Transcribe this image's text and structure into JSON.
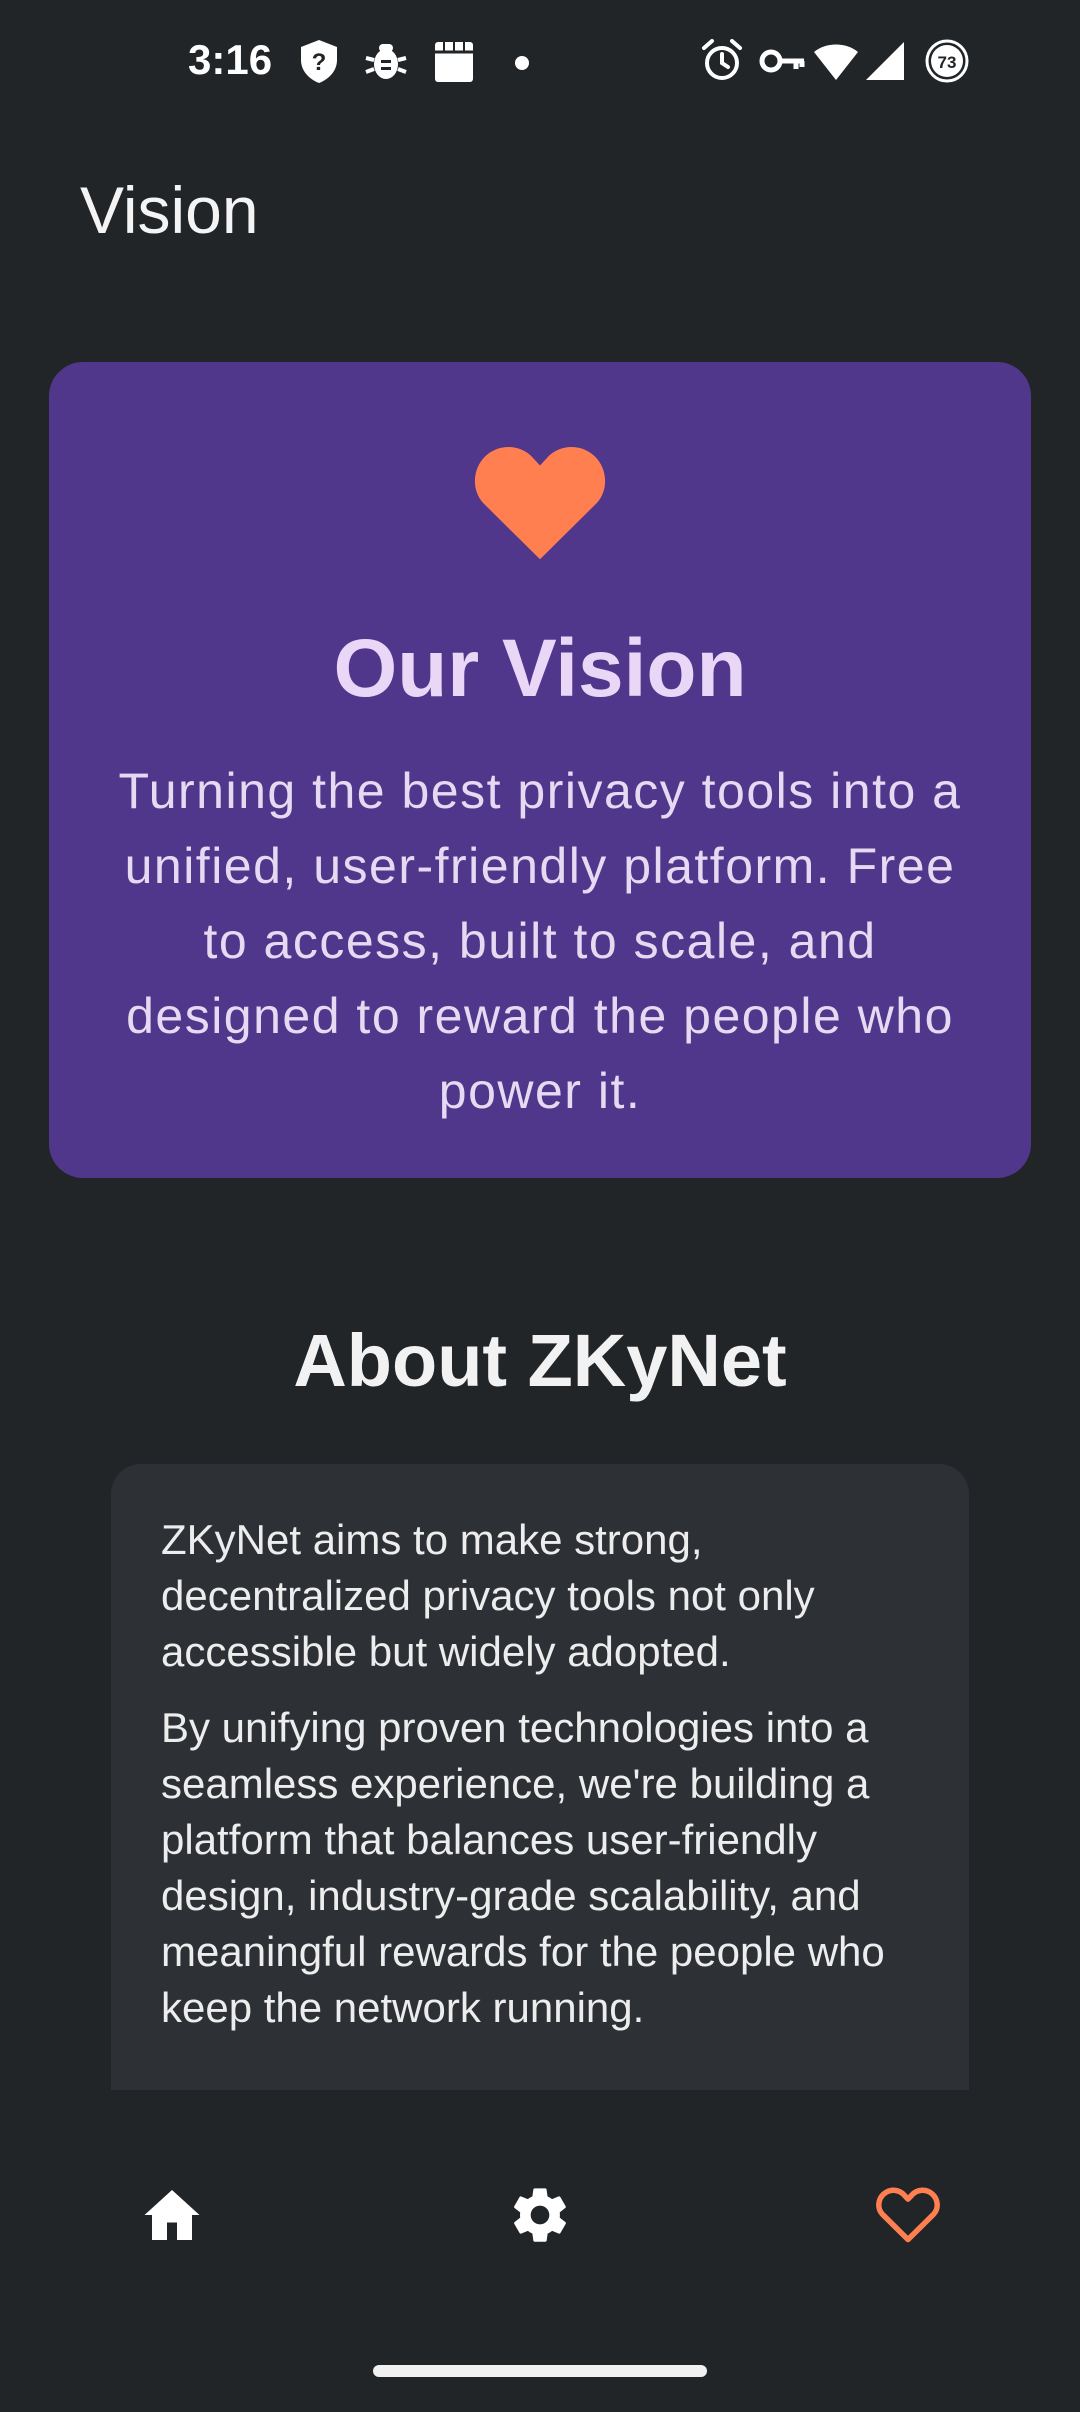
{
  "status_bar": {
    "time": "3:16",
    "battery_level": "73",
    "icons": [
      "shield-question-icon",
      "bug-icon",
      "storefront-icon",
      "dot-icon",
      "alarm-icon",
      "key-icon",
      "wifi-icon",
      "signal-icon",
      "battery-icon"
    ]
  },
  "header": {
    "title": "Vision"
  },
  "vision_card": {
    "icon": "heart-icon",
    "title": "Our Vision",
    "text": "Turning the best privacy tools into a unified, user-friendly platform. Free to access, built to scale, and designed to reward the people who power it.",
    "background_color": "#51378c",
    "accent_color": "#ff7f50"
  },
  "about": {
    "title": "About ZKyNet",
    "paragraph_1": "ZKyNet aims to make strong, decentralized privacy tools not only accessible but widely adopted.",
    "paragraph_2": "By unifying proven technologies into a seamless experience, we're building a platform that balances user-friendly design, industry-grade scalability, and meaningful rewards for the people who keep the network running."
  },
  "bottom_nav": {
    "items": [
      {
        "icon": "home-icon",
        "active": false
      },
      {
        "icon": "gear-icon",
        "active": false
      },
      {
        "icon": "heart-outline-icon",
        "active": true
      }
    ],
    "active_color": "#ff7f50"
  }
}
